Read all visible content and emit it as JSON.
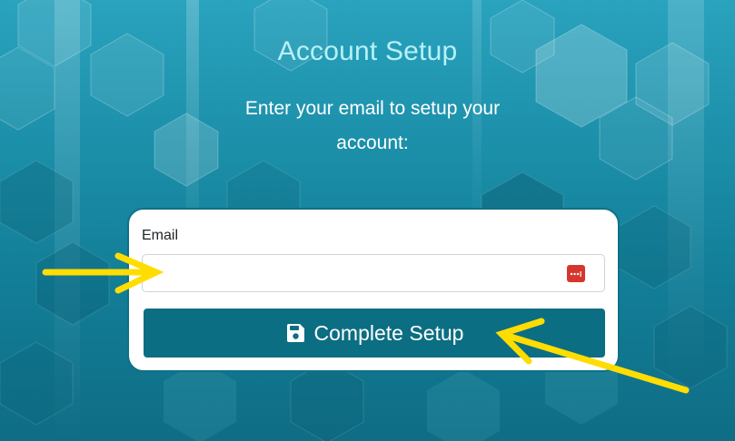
{
  "header": {
    "title": "Account Setup",
    "subtitle": "Enter your email to setup your account:"
  },
  "form": {
    "email_label": "Email",
    "email_value": "",
    "password_manager_icon": "password-manager-dots-icon",
    "submit_icon": "floppy-disk-icon",
    "submit_label": "Complete Setup"
  },
  "colors": {
    "background": "#1b8ea8",
    "title": "#b6f1f6",
    "button": "#0c6e82",
    "annotation_arrow": "#ffdd00",
    "password_icon": "#d5372f"
  }
}
